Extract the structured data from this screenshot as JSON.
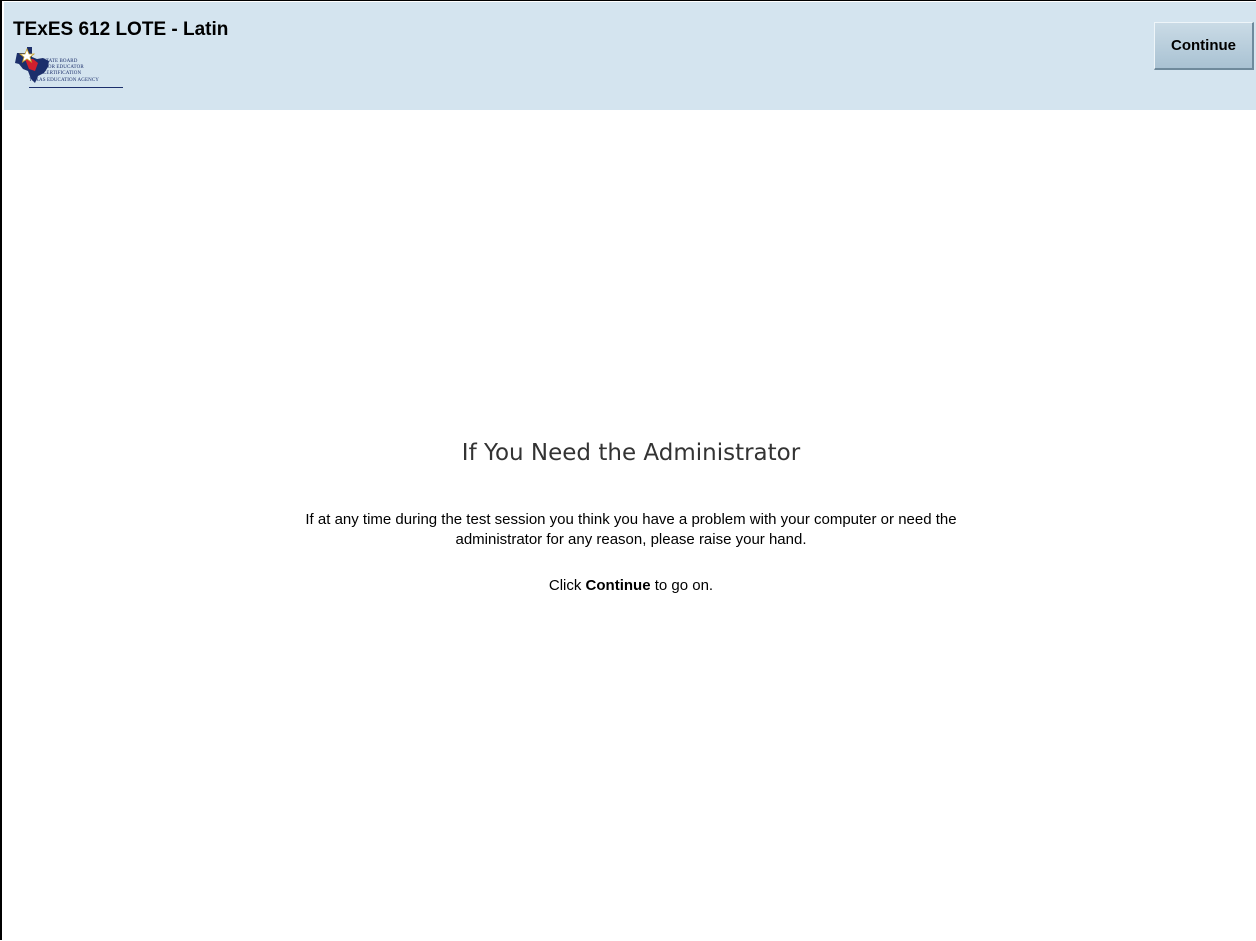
{
  "header": {
    "title": "TExES 612 LOTE - Latin",
    "continue_label": "Continue",
    "logo": {
      "line1": "STATE BOARD",
      "line2": "FOR EDUCATOR",
      "line3": "CERTIFICATION",
      "line4": "TEXAS EDUCATION AGENCY",
      "icon": "texas-star-map-logo",
      "colors": {
        "navy": "#1c2f6b",
        "red": "#d0202e"
      }
    }
  },
  "main": {
    "heading": "If You Need the Administrator",
    "body_line1": "If at any time during the test session you think you have a problem with your computer or need the",
    "body_line2": "administrator for any reason, please raise your hand.",
    "instruction_prefix": "Click",
    "instruction_bold": "Continue",
    "instruction_suffix": "to go on."
  },
  "colors": {
    "header_bg": "#d4e4ef",
    "button_bg": "#b8cedd",
    "heading_text": "#333333"
  }
}
